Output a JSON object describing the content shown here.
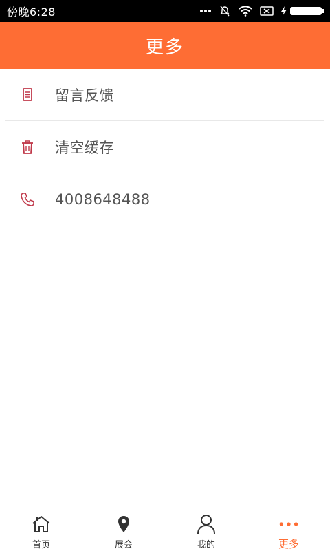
{
  "status_bar": {
    "time": "傍晚6:28"
  },
  "header": {
    "title": "更多"
  },
  "menu": {
    "items": [
      {
        "label": "留言反馈",
        "icon": "document-icon"
      },
      {
        "label": "清空缓存",
        "icon": "trash-icon"
      },
      {
        "label": "4008648488",
        "icon": "phone-icon"
      }
    ]
  },
  "tabbar": {
    "tabs": [
      {
        "label": "首页",
        "icon": "home-icon"
      },
      {
        "label": "展会",
        "icon": "location-pin-icon"
      },
      {
        "label": "我的",
        "icon": "user-icon"
      },
      {
        "label": "更多",
        "icon": "more-dots-icon",
        "active": true
      }
    ]
  },
  "colors": {
    "accent": "#fe6d34",
    "icon_red": "#c0394a"
  }
}
